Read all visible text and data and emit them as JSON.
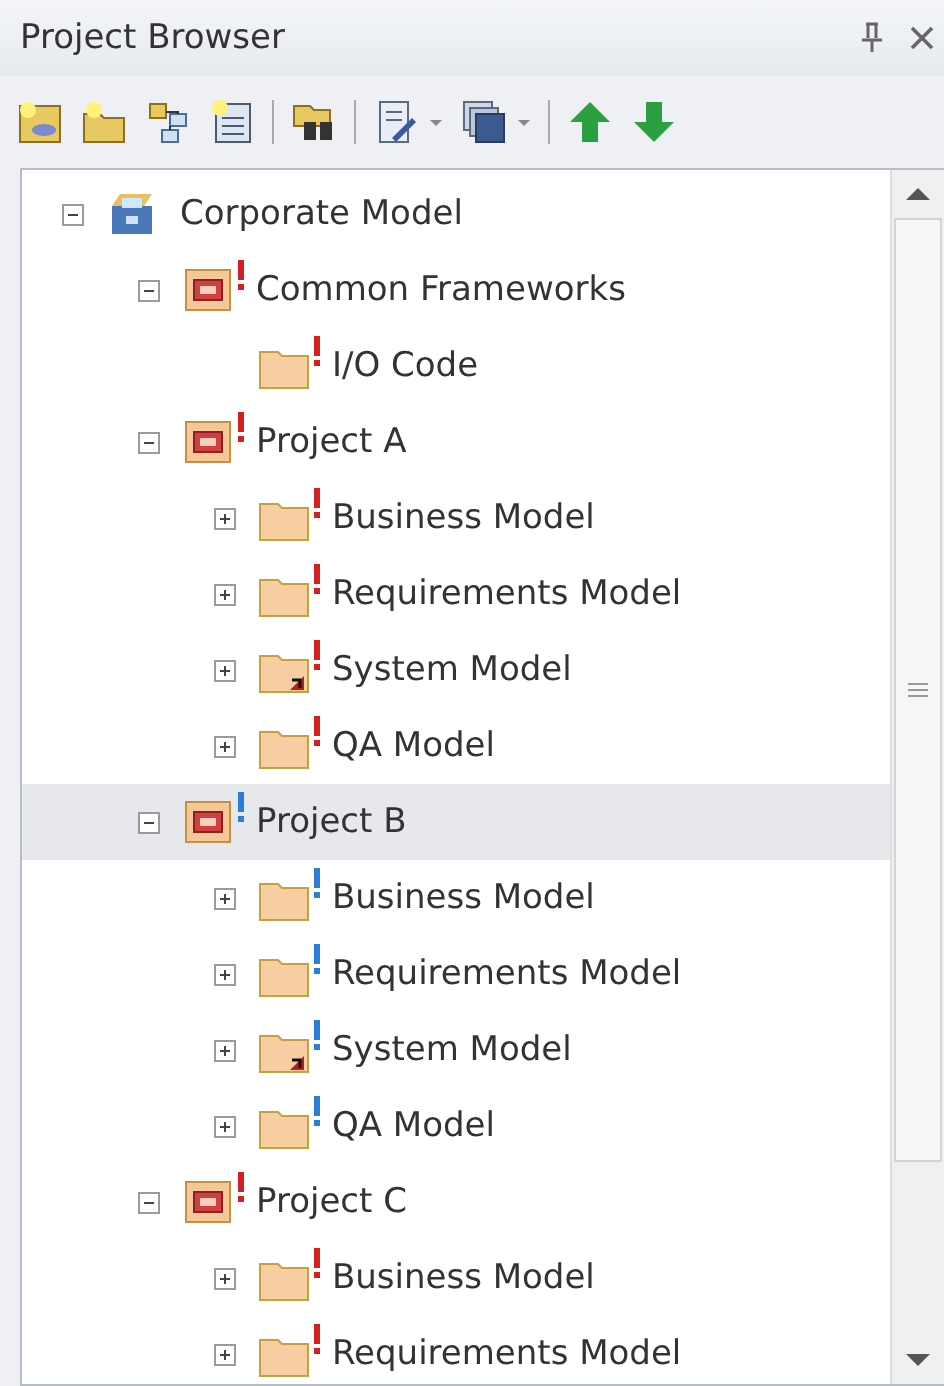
{
  "window": {
    "title": "Project Browser"
  },
  "tree": [
    {
      "label": "Corporate Model",
      "kind": "root",
      "expanded": true,
      "selected": false,
      "children": [
        {
          "label": "Common Frameworks",
          "kind": "package",
          "color": "#d42020",
          "expanded": true,
          "selected": false,
          "children": [
            {
              "label": "I/O Code",
              "kind": "folder",
              "color": "#d42020",
              "selected": false
            }
          ]
        },
        {
          "label": "Project A",
          "kind": "package",
          "color": "#d42020",
          "expanded": true,
          "selected": false,
          "children": [
            {
              "label": "Business Model",
              "kind": "folder",
              "color": "#d42020",
              "expanded": false,
              "selected": false
            },
            {
              "label": "Requirements Model",
              "kind": "folder",
              "color": "#d42020",
              "expanded": false,
              "selected": false
            },
            {
              "label": "System Model",
              "kind": "system",
              "color": "#d42020",
              "expanded": false,
              "selected": false
            },
            {
              "label": "QA Model",
              "kind": "folder",
              "color": "#d42020",
              "expanded": false,
              "selected": false
            }
          ]
        },
        {
          "label": "Project B",
          "kind": "package",
          "color": "#2a7fd4",
          "expanded": true,
          "selected": true,
          "children": [
            {
              "label": "Business Model",
              "kind": "folder",
              "color": "#2a7fd4",
              "expanded": false,
              "selected": false
            },
            {
              "label": "Requirements Model",
              "kind": "folder",
              "color": "#2a7fd4",
              "expanded": false,
              "selected": false
            },
            {
              "label": "System Model",
              "kind": "system",
              "color": "#2a7fd4",
              "expanded": false,
              "selected": false
            },
            {
              "label": "QA Model",
              "kind": "folder",
              "color": "#2a7fd4",
              "expanded": false,
              "selected": false
            }
          ]
        },
        {
          "label": "Project C",
          "kind": "package",
          "color": "#d42020",
          "expanded": true,
          "selected": false,
          "children": [
            {
              "label": "Business Model",
              "kind": "folder",
              "color": "#d42020",
              "expanded": false,
              "selected": false
            },
            {
              "label": "Requirements Model",
              "kind": "folder",
              "color": "#d42020",
              "expanded": false,
              "selected": false
            }
          ]
        }
      ]
    }
  ]
}
